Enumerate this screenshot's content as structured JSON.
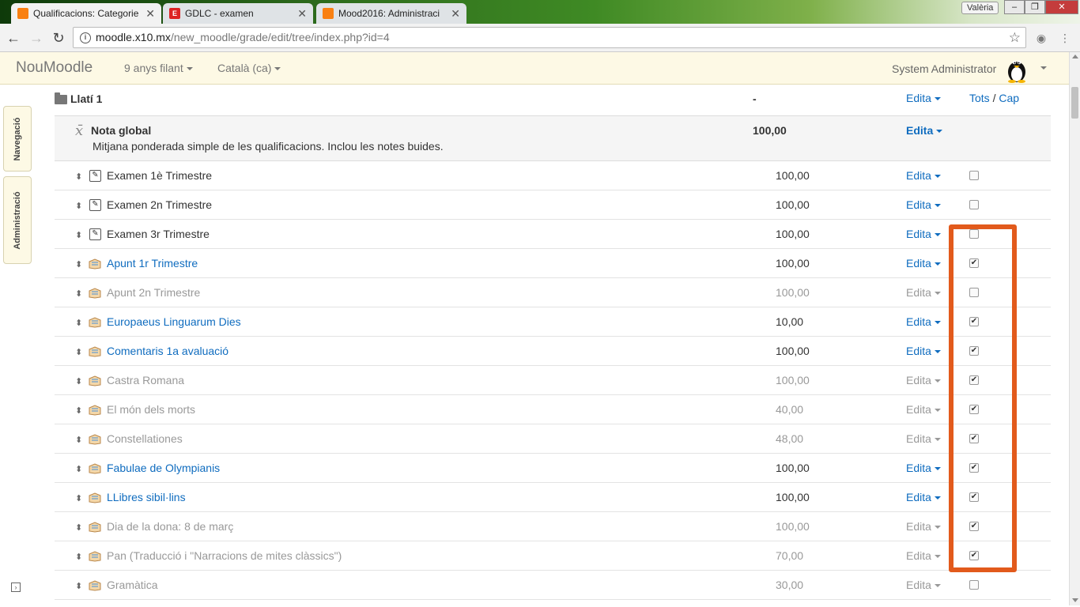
{
  "browser": {
    "tabs": [
      {
        "title": "Qualificacions: Categorie",
        "active": true,
        "favicon": "moodle-icon"
      },
      {
        "title": "GDLC - examen",
        "active": false,
        "favicon": "gdlc-icon"
      },
      {
        "title": "Mood2016: Administraci",
        "active": false,
        "favicon": "moodle-icon"
      }
    ],
    "profile_name": "Valèria",
    "url_host": "moodle.x10.mx",
    "url_path": "/new_moodle/grade/edit/tree/index.php?id=4"
  },
  "navbar": {
    "brand": "NouMoodle",
    "menu1": "9 anys filant",
    "menu2": "Català (ca)",
    "user": "System Administrator"
  },
  "dock": {
    "nav_label": "Navegació",
    "admin_label": "Administració"
  },
  "category": {
    "name": "Llatí 1",
    "value": "-",
    "edit_label": "Edita",
    "select_all": "Tots",
    "separator": "/",
    "select_none": "Cap"
  },
  "total": {
    "name": "Nota global",
    "description": "Mitjana ponderada simple de les qualificacions. Inclou les notes buides.",
    "value": "100,00",
    "edit_label": "Edita"
  },
  "items": [
    {
      "name": "Examen 1è Trimestre",
      "value": "100,00",
      "type": "manual",
      "style": "plain",
      "checked": false
    },
    {
      "name": "Examen 2n Trimestre",
      "value": "100,00",
      "type": "manual",
      "style": "plain",
      "checked": false
    },
    {
      "name": "Examen 3r Trimestre",
      "value": "100,00",
      "type": "manual",
      "style": "plain",
      "checked": false
    },
    {
      "name": "Apunt 1r Trimestre",
      "value": "100,00",
      "type": "assign",
      "style": "link",
      "checked": true
    },
    {
      "name": "Apunt 2n Trimestre",
      "value": "100,00",
      "type": "assign",
      "style": "dim",
      "checked": false
    },
    {
      "name": "Europaeus Linguarum Dies",
      "value": "10,00",
      "type": "assign",
      "style": "link",
      "checked": true
    },
    {
      "name": "Comentaris 1a avaluació",
      "value": "100,00",
      "type": "assign",
      "style": "link",
      "checked": true
    },
    {
      "name": "Castra Romana",
      "value": "100,00",
      "type": "assign",
      "style": "dim",
      "checked": true
    },
    {
      "name": "El món dels morts",
      "value": "40,00",
      "type": "assign",
      "style": "dim",
      "checked": true
    },
    {
      "name": "Constellationes",
      "value": "48,00",
      "type": "assign",
      "style": "dim",
      "checked": true
    },
    {
      "name": "Fabulae de Olympianis",
      "value": "100,00",
      "type": "assign",
      "style": "link",
      "checked": true
    },
    {
      "name": "LLibres sibil·lins",
      "value": "100,00",
      "type": "assign",
      "style": "link",
      "checked": true
    },
    {
      "name": "Dia de la dona: 8 de març",
      "value": "100,00",
      "type": "assign",
      "style": "dim",
      "checked": true
    },
    {
      "name": "Pan (Traducció i \"Narracions de mites clàssics\")",
      "value": "70,00",
      "type": "assign",
      "style": "dim",
      "checked": true
    },
    {
      "name": "Gramàtica",
      "value": "30,00",
      "type": "assign",
      "style": "dim",
      "checked": false
    }
  ],
  "edit_label": "Edita",
  "colors": {
    "link": "#0f6cbf",
    "dim": "#999999",
    "highlight": "#e25a1c",
    "navbar_bg": "#fdf9e5"
  }
}
